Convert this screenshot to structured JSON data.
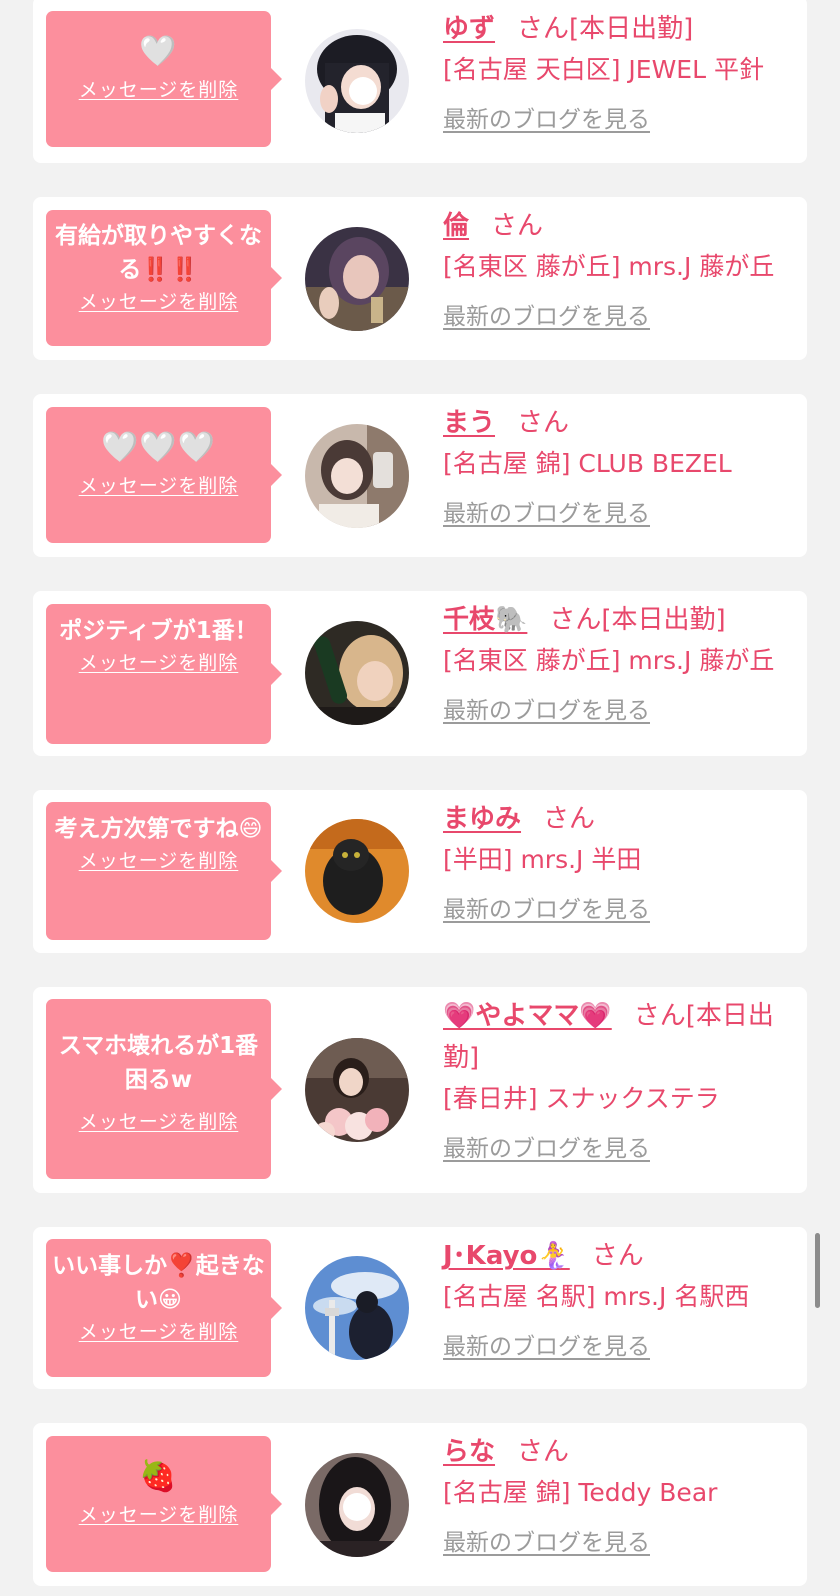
{
  "common": {
    "delete_label": "メッセージを削除",
    "san_label": "さん",
    "blog_label": "最新のブログを見る"
  },
  "colors": {
    "accent_pink": "#e8486c",
    "bubble_pink": "#fc8f9d",
    "link_gray": "#9b9b9b",
    "background": "#f2f2f2"
  },
  "cards": [
    {
      "message": "🤍",
      "name": "ゆず",
      "suffix": "[本日出勤]",
      "shop": "[名古屋 天白区] JEWEL 平針",
      "avatar_icon": "profile-photo-icon"
    },
    {
      "message": "有給が取りやすくなる‼️‼️",
      "name": "倫",
      "suffix": "",
      "shop": "[名東区 藤が丘] mrs.J 藤が丘",
      "avatar_icon": "profile-photo-icon"
    },
    {
      "message": "🤍🤍🤍",
      "name": "まう",
      "suffix": "",
      "shop": "[名古屋 錦] CLUB BEZEL",
      "avatar_icon": "profile-photo-icon"
    },
    {
      "message": "ポジティブが1番！",
      "name": "千枝🐘",
      "suffix": "[本日出勤]",
      "shop": "[名東区 藤が丘] mrs.J 藤が丘",
      "avatar_icon": "profile-photo-icon"
    },
    {
      "message": "考え方次第ですね😄",
      "name": "まゆみ",
      "suffix": "",
      "shop": "[半田] mrs.J 半田",
      "avatar_icon": "profile-photo-icon"
    },
    {
      "message": "スマホ壊れるが1番困るw",
      "name": "💗やよママ💗",
      "suffix": "[本日出勤]",
      "shop": "[春日井] スナックステラ",
      "avatar_icon": "profile-photo-icon"
    },
    {
      "message": "いい事しか❣️起きない😀",
      "name": "J･Kayo🧜‍♀️",
      "suffix": "",
      "shop": "[名古屋 名駅] mrs.J 名駅西",
      "avatar_icon": "profile-photo-icon"
    },
    {
      "message": "🍓",
      "name": "らな",
      "suffix": "",
      "shop": "[名古屋 錦] Teddy Bear",
      "avatar_icon": "profile-photo-icon"
    }
  ]
}
